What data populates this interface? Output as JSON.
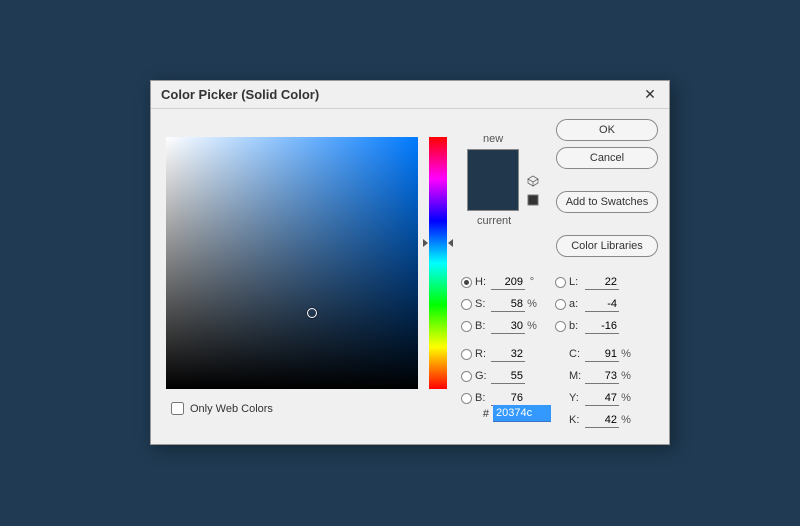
{
  "title": "Color Picker (Solid Color)",
  "buttons": {
    "ok": "OK",
    "cancel": "Cancel",
    "add_swatches": "Add to Swatches",
    "color_libraries": "Color Libraries"
  },
  "preview": {
    "new_label": "new",
    "current_label": "current",
    "new_color": "#20374c",
    "current_color": "#20374c"
  },
  "only_web_label": "Only Web Colors",
  "only_web_checked": false,
  "selected_mode": "H",
  "hsb": {
    "h": "209",
    "s": "58",
    "b": "30"
  },
  "rgb": {
    "r": "32",
    "g": "55",
    "b": "76"
  },
  "lab": {
    "l": "22",
    "a": "-4",
    "b": "-16"
  },
  "cmyk": {
    "c": "91",
    "m": "73",
    "y": "47",
    "k": "42"
  },
  "units": {
    "degree": "°",
    "percent": "%"
  },
  "labels": {
    "h": "H:",
    "s": "S:",
    "bb": "B:",
    "r": "R:",
    "g": "G:",
    "b2": "B:",
    "l": "L:",
    "a": "a:",
    "lb": "b:",
    "c": "C:",
    "m": "M:",
    "y": "Y:",
    "k": "K:",
    "hash": "#"
  },
  "hex": "20374c",
  "picker": {
    "x_pct": 58,
    "y_pct": 70
  },
  "hue_marker_pct": 42
}
